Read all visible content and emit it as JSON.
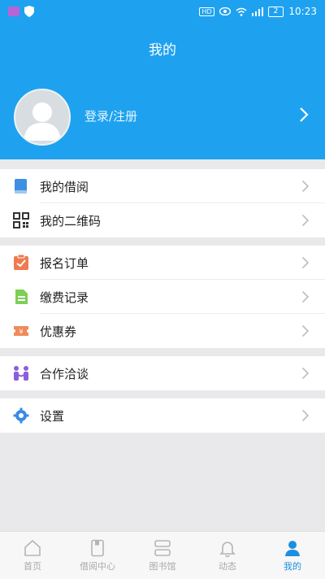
{
  "status": {
    "left_icons": [
      "app-icon",
      "shield-icon"
    ],
    "right_icons": [
      "hd-icon",
      "eye-icon",
      "wifi-icon",
      "signal-icon",
      "battery-icon"
    ],
    "battery": "2",
    "time": "10:23"
  },
  "header": {
    "title": "我的",
    "login": "登录/注册"
  },
  "menu": {
    "group1": [
      {
        "label": "我的借阅"
      },
      {
        "label": "我的二维码"
      }
    ],
    "group2": [
      {
        "label": "报名订单"
      },
      {
        "label": "缴费记录"
      },
      {
        "label": "优惠券"
      }
    ],
    "group3": [
      {
        "label": "合作洽谈"
      }
    ],
    "group4": [
      {
        "label": "设置"
      }
    ]
  },
  "tabs": [
    {
      "label": "首页"
    },
    {
      "label": "借阅中心"
    },
    {
      "label": "图书馆"
    },
    {
      "label": "动态"
    },
    {
      "label": "我的"
    }
  ],
  "colors": {
    "primary": "#1ea2f0",
    "active_tab": "#1e8fe0",
    "order_icon": "#f07a4f",
    "fee_icon": "#7dcf55",
    "coupon_icon": "#f08a5b",
    "coop_icon": "#8b5fd9",
    "settings_icon": "#3b8be6",
    "book_icon": "#3e8fe2"
  }
}
